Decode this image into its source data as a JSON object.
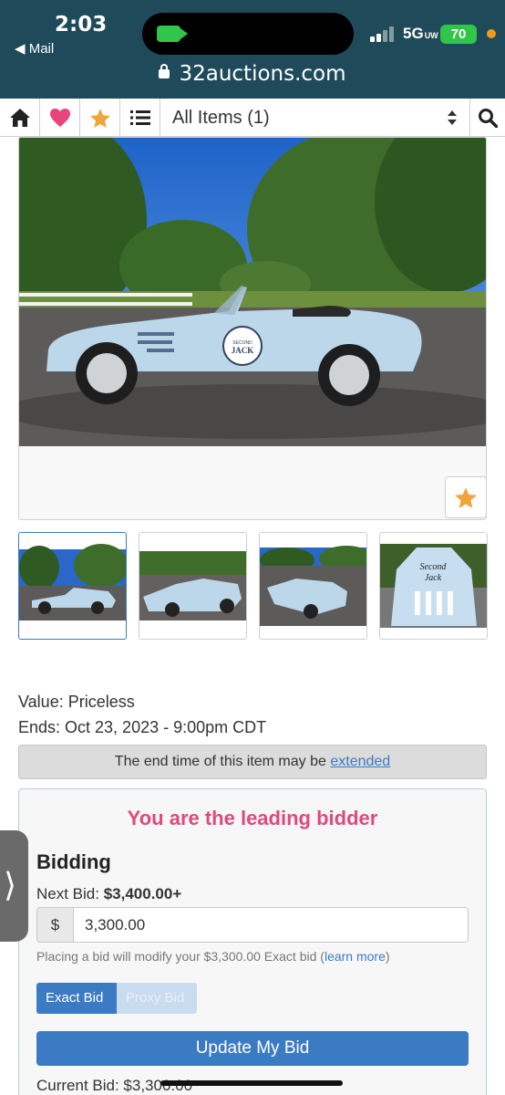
{
  "status_bar": {
    "time": "2:03",
    "back_label": "◀ Mail",
    "network": "5G",
    "network_sub": "UW",
    "battery": "70"
  },
  "browser": {
    "url": "32auctions.com"
  },
  "toolbar": {
    "home_icon": "home-icon",
    "heart_icon": "heart-icon",
    "star_icon": "star-icon",
    "list_icon": "list-icon",
    "category_select": "All Items (1)",
    "search_icon": "search-icon",
    "colors": {
      "heart": "#e8457a",
      "star": "#f2a33a"
    }
  },
  "item": {
    "value_text": "Value: Priceless",
    "ends_text": "Ends: Oct 23, 2023 - 9:00pm CDT",
    "notice_prefix": "The end time of this item may be ",
    "notice_link": "extended",
    "car_logo": {
      "line1": "SECOND",
      "line2": "JACK"
    },
    "thumb_logo": {
      "line1": "Second",
      "line2": "Jack"
    }
  },
  "bidding": {
    "status": "You are the leading bidder",
    "heading": "Bidding",
    "next_bid_label": "Next Bid: ",
    "next_bid_value": "$3,400.00+",
    "currency": "$",
    "amount": "3,300.00",
    "helper_text": "Placing a bid will modify your $3,300.00 Exact bid (",
    "helper_link": "learn more",
    "helper_close": ")",
    "exact_tab": "Exact Bid",
    "proxy_tab": "Proxy Bid",
    "update_button": "Update My Bid",
    "current_bid": "Current Bid: $3,300.00",
    "colors": {
      "leading": "#de4a7c",
      "primary": "#3b7bc4"
    }
  }
}
